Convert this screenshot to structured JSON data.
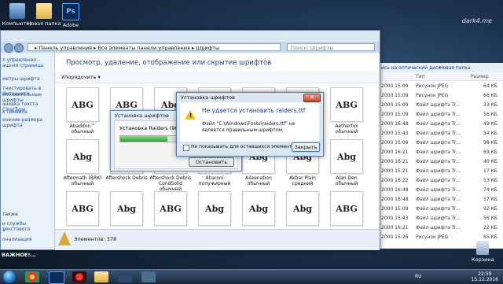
{
  "desktop": {
    "icons": [
      {
        "label": "Компьютер"
      },
      {
        "label": "Новая папка"
      },
      {
        "label": "Adobe"
      }
    ],
    "watermark": "dark4.me",
    "recycle_bin": "Корзина",
    "bottom_left_text": "ВАЖНОЕ!..."
  },
  "explorer": {
    "address_path": "▸ Панель управления ▸ Все элементы панели управления ▸ Шрифты",
    "search_placeholder": "Поиск: Шрифты",
    "left_pane": {
      "top_links": [
        "л управления -",
        "ашняя страница"
      ],
      "links": [
        "метры шрифта",
        "тнистировать в Интернете",
        "ополнительные шрифты",
        "ановка текста ClearType",
        "к символа",
        "енение размера шрифта"
      ],
      "see_also": [
        "также",
        "и службы текстового",
        "а",
        "онализация"
      ]
    },
    "heading": "Просмотр, удаление, отображение или скрытие шрифтов",
    "organize_label": "Упорядочить ▾",
    "fonts": [
      {
        "glyph": "ABG",
        "name": "Abaddon™",
        "style": "обычный"
      },
      {
        "glyph": "ABG",
        "name": "",
        "style": ""
      },
      {
        "glyph": "Abg",
        "name": "",
        "style": ""
      },
      {
        "glyph": "Abg",
        "name": "",
        "style": ""
      },
      {
        "glyph": "Abg",
        "name": "",
        "style": ""
      },
      {
        "glyph": "Abg",
        "name": "",
        "style": ""
      },
      {
        "glyph": "ABG",
        "name": "Aetherfox",
        "style": "обычный"
      },
      {
        "glyph": "Abg",
        "name": "Aftermath (BRK)",
        "style": "обычный"
      },
      {
        "glyph": "ABG",
        "name": "Aftershock Debris",
        "style": ""
      },
      {
        "glyph": "Abg",
        "name": "Aftershock Debris CondSolid",
        "style": "обычный"
      },
      {
        "glyph": "Abg",
        "name": "Aharoni",
        "style": "полужирный"
      },
      {
        "glyph": "Abg",
        "name": "Aileenation",
        "style": "обычный"
      },
      {
        "glyph": "Abg",
        "name": "Akbar Plain",
        "style": "средний"
      },
      {
        "glyph": "Abg",
        "name": "Alan Den",
        "style": "обычный"
      },
      {
        "glyph": "ABG",
        "name": "",
        "style": ""
      },
      {
        "glyph": "Abg",
        "name": "",
        "style": ""
      },
      {
        "glyph": "ABG",
        "name": "",
        "style": ""
      },
      {
        "glyph": "Abg",
        "name": "",
        "style": ""
      },
      {
        "glyph": "Abg",
        "name": "",
        "style": ""
      },
      {
        "glyph": "Abg",
        "name": "",
        "style": ""
      },
      {
        "glyph": "ABG",
        "name": "",
        "style": ""
      }
    ],
    "status": "Элементов: 378"
  },
  "right_window": {
    "toolbar": [
      "ись на оптический диск",
      "Новая папка"
    ],
    "columns": [
      "",
      "Тип",
      "Размер"
    ],
    "rows": [
      {
        "date": "2000 15:09",
        "type": "Рисунок JPEG",
        "size": "64 КБ"
      },
      {
        "date": "2000 15:09",
        "type": "Рисунок JPEG",
        "size": "66 КБ"
      },
      {
        "date": "2000 15:09",
        "type": "Файл шрифта Tr...",
        "size": "33 КБ"
      },
      {
        "date": "2000 15:09",
        "type": "Файл шрифта Tr...",
        "size": "56 КБ"
      },
      {
        "date": "2000 16:48",
        "type": "Файл шрифта Tr...",
        "size": "49 КБ"
      },
      {
        "date": "2000 15:43",
        "type": "Файл шрифта Tr...",
        "size": "54 КБ"
      },
      {
        "date": "2000 15:09",
        "type": "Файл шрифта Tr...",
        "size": "98 КБ"
      },
      {
        "date": "2000 16:21",
        "type": "Файл шрифта Tr...",
        "size": "69 КБ"
      },
      {
        "date": "2000 16:21",
        "type": "Файл шрифта Tr...",
        "size": "40 КБ"
      },
      {
        "date": "2000 15:21",
        "type": "Файл шрифта Tr...",
        "size": "17 КБ"
      },
      {
        "date": "2000 16:22",
        "type": "Файл шрифта Tr...",
        "size": "53 КБ"
      },
      {
        "date": "2000 16:48",
        "type": "Файл шрифта Tr...",
        "size": "74 КБ"
      },
      {
        "date": "2000 16:48",
        "type": "Файл шрифта Tr...",
        "size": "57 КБ"
      },
      {
        "date": "2000 15:09",
        "type": "Файл шрифта Tr...",
        "size": "92 КБ"
      },
      {
        "date": "2000 15:43",
        "type": "Файл шрифта Tr...",
        "size": "56 КБ"
      },
      {
        "date": "2000 16:21",
        "type": "Файл шрифта Tr...",
        "size": "22 КБ"
      },
      {
        "date": "2000 15:26",
        "type": "Рисунок JPEG",
        "size": "65 КБ"
      }
    ]
  },
  "progress_dialog": {
    "title": "Установка шрифтов",
    "message": "Установка Raiders  (98 из 259)",
    "progress_fraction": 0.42,
    "stop_label": "Остановить"
  },
  "error_dialog": {
    "title": "Установка шрифтов",
    "close_glyph": "✕",
    "main_message": "Не удается установить raiders.ttf",
    "sub_message": "Файл \"C:\\Windows\\Fonts\\raiders.ttf\" не является правильным шрифтом.",
    "checkbox_label": "Не показывать для оставшихся элементов",
    "close_label": "Закрыть"
  },
  "taskbar": {
    "lang": "RU",
    "time": "22:59",
    "date": "15.12.2016"
  }
}
